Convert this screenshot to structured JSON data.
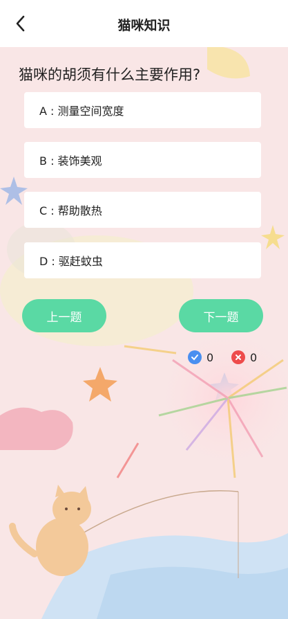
{
  "header": {
    "title": "猫咪知识",
    "back_icon": "chevron-left-icon"
  },
  "quiz": {
    "question": "猫咪的胡须有什么主要作用?",
    "options": [
      {
        "label": "A : 测量空间宽度"
      },
      {
        "label": "B : 装饰美观"
      },
      {
        "label": "C : 帮助散热"
      },
      {
        "label": "D : 驱赶蚊虫"
      }
    ],
    "prev_label": "上一题",
    "next_label": "下一题"
  },
  "score": {
    "correct_count": "0",
    "wrong_count": "0",
    "correct_icon": "check-circle-icon",
    "wrong_icon": "x-circle-icon"
  },
  "colors": {
    "accent": "#5ad9a4",
    "correct": "#4a8ff0",
    "wrong": "#ee4b4b",
    "background": "#f9e6e6"
  }
}
